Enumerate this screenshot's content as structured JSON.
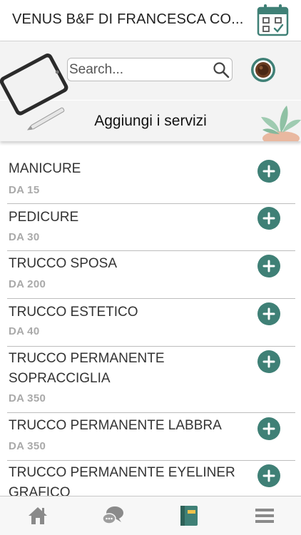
{
  "header": {
    "title": "VENUS B&F DI FRANCESCA CO...",
    "calendar_icon": "calendar-check-icon"
  },
  "banner": {
    "search_placeholder": "Search...",
    "search_icon": "search-icon",
    "avatar_icon": "coffee-cup-avatar",
    "title": "Aggiungi i servizi"
  },
  "services": [
    {
      "name": "MANICURE",
      "price": "DA 15"
    },
    {
      "name": "PEDICURE",
      "price": "DA 30"
    },
    {
      "name": "TRUCCO SPOSA",
      "price": "DA 200"
    },
    {
      "name": "TRUCCO ESTETICO",
      "price": "DA 40"
    },
    {
      "name": "TRUCCO PERMANENTE SOPRACCIGLIA",
      "price": "DA 350"
    },
    {
      "name": "TRUCCO PERMANENTE LABBRA",
      "price": "DA 350"
    },
    {
      "name": "TRUCCO PERMANENTE EYELINER GRAFICO",
      "price": ""
    }
  ],
  "bottom_nav": [
    {
      "icon": "home-icon"
    },
    {
      "icon": "chat-icon"
    },
    {
      "icon": "notebook-icon",
      "active": true
    },
    {
      "icon": "menu-icon"
    }
  ],
  "colors": {
    "accent": "#3f8076",
    "price_text": "#a9a9a9",
    "banner_bg": "#f3f3f3"
  }
}
